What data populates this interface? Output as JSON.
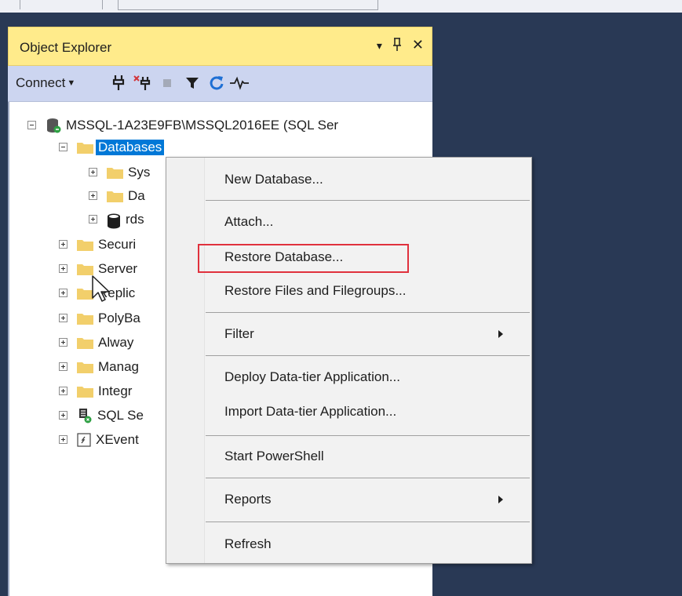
{
  "object_explorer": {
    "title": "Object Explorer",
    "title_buttons": {
      "dropdown": "▾",
      "pin": "ꟸ",
      "close": "✕"
    },
    "toolbar": {
      "connect_label": "Connect",
      "icons": [
        "connect-plug-icon",
        "disconnect-icon",
        "stop-icon",
        "filter-icon",
        "refresh-icon",
        "activity-monitor-icon"
      ]
    },
    "tree": {
      "server": "MSSQL-1A23E9FB\\MSSQL2016EE (SQL Ser",
      "databases": "Databases",
      "db_children": [
        "Sys",
        "Da",
        "rds"
      ],
      "server_children": [
        "Securi",
        "Server",
        "Replic",
        "PolyBa",
        "Alway",
        "Manag",
        "Integr",
        "SQL Se",
        "XEvent"
      ]
    }
  },
  "context_menu": {
    "items": [
      "New Database...",
      "Attach...",
      "Restore Database...",
      "Restore Files and Filegroups...",
      "Filter",
      "Deploy Data-tier Application...",
      "Import Data-tier Application...",
      "Start PowerShell",
      "Reports",
      "Refresh"
    ],
    "highlighted_item": "Restore Database...",
    "highlight_color": "#e0313d"
  },
  "colors": {
    "background": "#293955",
    "title_bar": "#ffeb8b",
    "toolbar": "#ccd5f0",
    "selection": "#0078d7",
    "folder": "#f2cf6b"
  }
}
